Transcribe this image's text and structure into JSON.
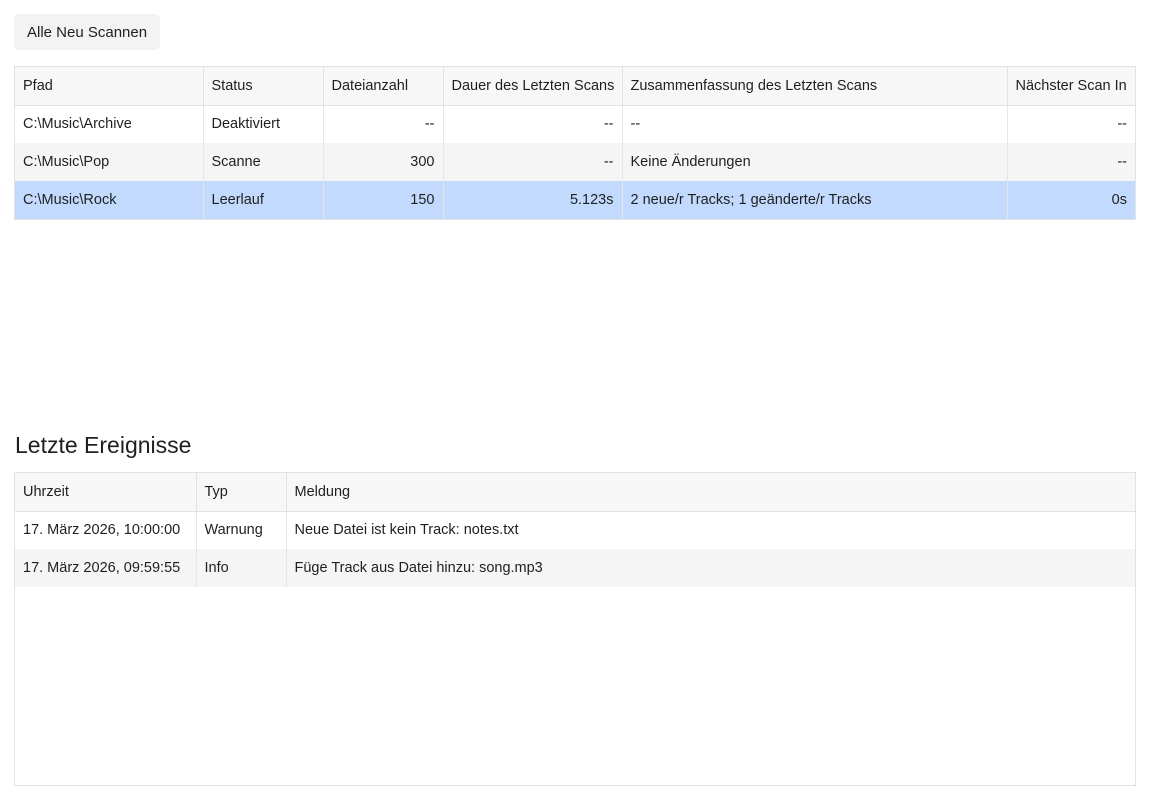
{
  "toolbar": {
    "rescan_all_label": "Alle Neu Scannen"
  },
  "folders_table": {
    "columns": [
      "Pfad",
      "Status",
      "Dateianzahl",
      "Dauer des Letzten Scans",
      "Zusammenfassung des Letzten Scans",
      "Nächster Scan In"
    ],
    "rows": [
      {
        "path": "C:\\Music\\Archive",
        "status": "Deaktiviert",
        "file_count": "--",
        "last_scan_duration": "--",
        "last_scan_summary": "--",
        "next_scan_in": "--"
      },
      {
        "path": "C:\\Music\\Pop",
        "status": "Scanne",
        "file_count": "300",
        "last_scan_duration": "--",
        "last_scan_summary": "Keine Änderungen",
        "next_scan_in": "--"
      },
      {
        "path": "C:\\Music\\Rock",
        "status": "Leerlauf",
        "file_count": "150",
        "last_scan_duration": "5.123s",
        "last_scan_summary": "2 neue/r Tracks; 1 geänderte/r Tracks",
        "next_scan_in": "0s"
      }
    ],
    "selected_row": 2
  },
  "events": {
    "title": "Letzte Ereignisse",
    "columns": [
      "Uhrzeit",
      "Typ",
      "Meldung"
    ],
    "rows": [
      {
        "time": "17. März 2026, 10:00:00",
        "type": "Warnung",
        "message": "Neue Datei ist kein Track: notes.txt"
      },
      {
        "time": "17. März 2026, 09:59:55",
        "type": "Info",
        "message": "Füge Track aus Datei hinzu: song.mp3"
      }
    ]
  },
  "colors": {
    "selected_row_bg": "#c3daff",
    "header_bg": "#f7f7f8",
    "stripe_bg": "#f5f5f5",
    "button_bg": "#f3f3f3"
  }
}
